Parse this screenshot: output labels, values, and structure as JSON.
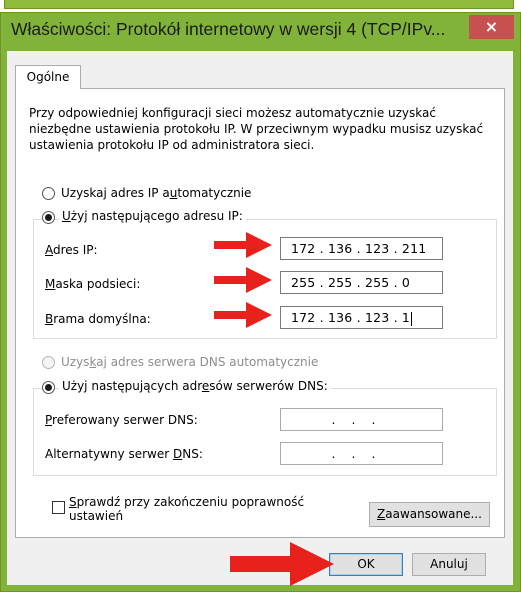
{
  "window": {
    "title": "Właściwości: Protokół internetowy w wersji 4 (TCP/IPv...",
    "close_glyph": "×",
    "frame_color": "#81b33a"
  },
  "tabs": [
    {
      "label": "Ogólne"
    }
  ],
  "description": "Przy odpowiedniej konfiguracji sieci możesz automatycznie uzyskać niezbędne ustawienia protokołu IP. W przeciwnym wypadku musisz uzyskać ustawienia protokołu IP od administratora sieci.",
  "ip_section": {
    "auto_radio_label": "Uzyskaj adres IP automatycznie",
    "auto_selected": false,
    "manual_radio_label": "Użyj następującego adresu IP:",
    "manual_selected": true,
    "fields": [
      {
        "label": "Adres IP:",
        "value": "172 . 136 . 123 . 211"
      },
      {
        "label": "Maska podsieci:",
        "value": "255 . 255 . 255 .  0"
      },
      {
        "label": "Brama domyślna:",
        "value": "172 . 136 . 123 .  1"
      }
    ]
  },
  "dns_section": {
    "auto_radio_label": "Uzyskaj adres serwera DNS automatycznie",
    "auto_enabled": false,
    "manual_radio_label": "Użyj następujących adresów serwerów DNS:",
    "manual_selected": true,
    "fields": [
      {
        "label": "Preferowany serwer DNS:",
        "value": "..."
      },
      {
        "label": "Alternatywny serwer DNS:",
        "value": "..."
      }
    ]
  },
  "validate_checkbox": {
    "label_line1": "Sprawdź przy zakończeniu poprawność",
    "label_line2": "ustawień",
    "checked": false
  },
  "buttons": {
    "advanced": "Zaawansowane...",
    "ok": "OK",
    "cancel": "Anuluj"
  },
  "annotation_color": "#e8211c"
}
